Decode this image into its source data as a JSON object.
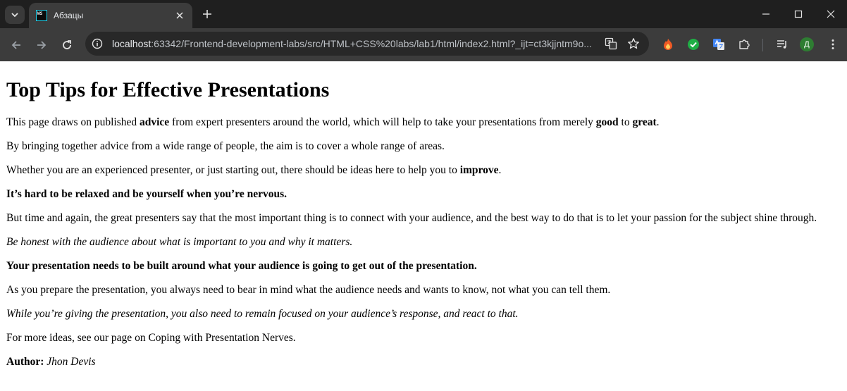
{
  "browser": {
    "tab_title": "Абзацы",
    "favicon_text": "WS",
    "url_host": "localhost",
    "url_rest": ":63342/Frontend-development-labs/src/HTML+CSS%20labs/lab1/html/index2.html?_ijt=ct3kjjntm9o...",
    "profile_initial": "Д"
  },
  "article": {
    "title": "Top Tips for Effective Presentations",
    "p1": {
      "a": "This page draws on published ",
      "b1": "advice",
      "c": " from expert presenters around the world, which will help to take your presentations from merely ",
      "b2": "good",
      "d": " to ",
      "b3": "great",
      "e": "."
    },
    "p2": "By bringing together advice from a wide range of people, the aim is to cover a whole range of areas.",
    "p3": {
      "a": "Whether you are an experienced presenter, or just starting out, there should be ideas here to help you to ",
      "b": "improve",
      "c": "."
    },
    "p4": "It’s hard to be relaxed and be yourself when you’re nervous.",
    "p5": "But time and again, the great presenters say that the most important thing is to connect with your audience, and the best way to do that is to let your passion for the subject shine through.",
    "p6": "Be honest with the audience about what is important to you and why it matters.",
    "p7": "Your presentation needs to be built around what your audience is going to get out of the presentation.",
    "p8": "As you prepare the presentation, you always need to bear in mind what the audience needs and wants to know, not what you can tell them.",
    "p9": "While you’re giving the presentation, you also need to remain focused on your audience’s response, and react to that.",
    "p10": "For more ideas, see our page on Coping with Presentation Nerves.",
    "author_label": "Author:",
    "author_name": " Jhon Devis"
  },
  "icons": {
    "tab_search": "chevron-down-icon",
    "close": "close-icon",
    "new_tab": "plus-icon",
    "minimize": "minimize-icon",
    "maximize": "maximize-icon",
    "window_close": "window-close-icon",
    "back": "back-arrow-icon",
    "forward": "forward-arrow-icon",
    "reload": "reload-icon",
    "site_info": "info-icon",
    "translate": "translate-icon",
    "bookmark": "star-icon",
    "extensions": [
      "fire-extension-icon",
      "check-extension-icon",
      "google-translate-extension-icon",
      "puzzle-icon"
    ],
    "media": "media-queue-icon",
    "menu": "kebab-menu-icon"
  }
}
